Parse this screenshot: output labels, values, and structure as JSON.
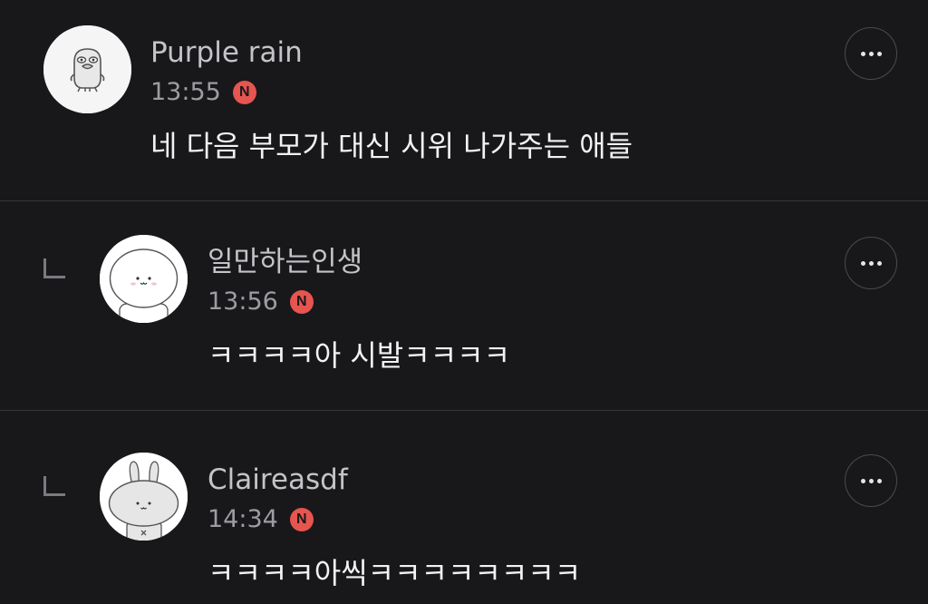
{
  "comments": [
    {
      "username": "Purple rain",
      "time": "13:55",
      "badge": "N",
      "text": "네 다음 부모가 대신 시위 나가주는 애들",
      "is_reply": false,
      "avatar_icon": "duck-character-icon"
    },
    {
      "username": "일만하는인생",
      "time": "13:56",
      "badge": "N",
      "text": "ㅋㅋㅋㅋ아 시발ㅋㅋㅋㅋ",
      "is_reply": true,
      "avatar_icon": "white-blob-character-icon"
    },
    {
      "username": "Claireasdf",
      "time": "14:34",
      "badge": "N",
      "text": "ㅋㅋㅋㅋ아씩ㅋㅋㅋㅋㅋㅋㅋㅋ",
      "is_reply": true,
      "avatar_icon": "bunny-character-icon"
    }
  ],
  "more_icon": "more-dots-icon",
  "reply_icon": "reply-arrow-icon",
  "colors": {
    "background": "#18181b",
    "divider": "#36363a",
    "username": "#c4c4c8",
    "timestamp": "#9c9ca2",
    "body": "#f2f2f2",
    "new_badge": "#e6554f"
  }
}
